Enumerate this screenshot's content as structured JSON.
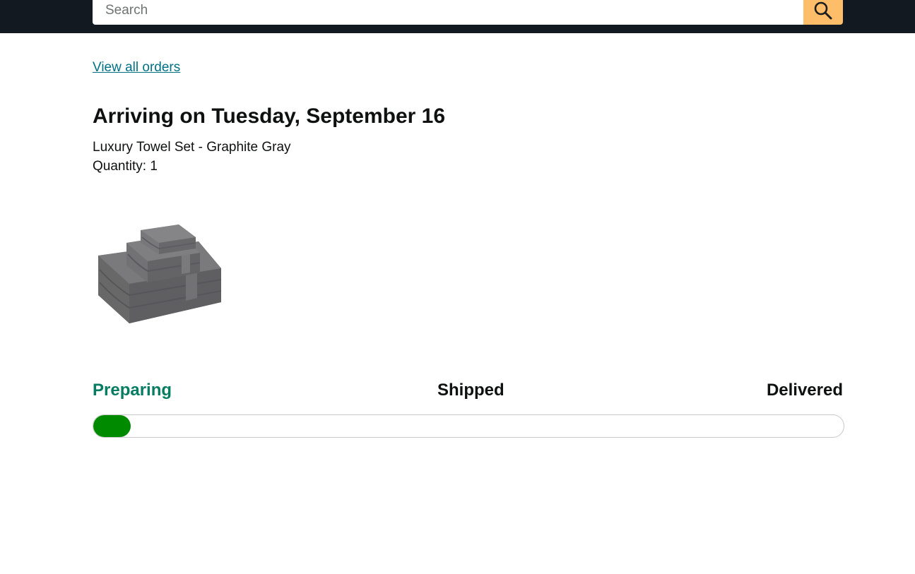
{
  "header": {
    "search": {
      "placeholder": "Search",
      "value": ""
    },
    "search_button_icon": "search-icon"
  },
  "order": {
    "view_all_link": "View all orders",
    "arrival_title": "Arriving on Tuesday, September 16",
    "product_name": "Luxury Towel Set - Graphite Gray",
    "quantity_label": "Quantity: 1",
    "product_image_icon": "towel-stack-image"
  },
  "tracking": {
    "steps": [
      {
        "label": "Preparing",
        "status": "current"
      },
      {
        "label": "Shipped",
        "status": "pending"
      },
      {
        "label": "Delivered",
        "status": "pending"
      }
    ],
    "progress_fraction": 0.05
  },
  "colors": {
    "header_bg": "#131921",
    "search_button_bg": "#febd69",
    "link": "#007185",
    "current_step": "#067d62",
    "pending_step": "#0f1111",
    "progress_fill": "#008a00",
    "progress_border": "#c8c8c8"
  }
}
